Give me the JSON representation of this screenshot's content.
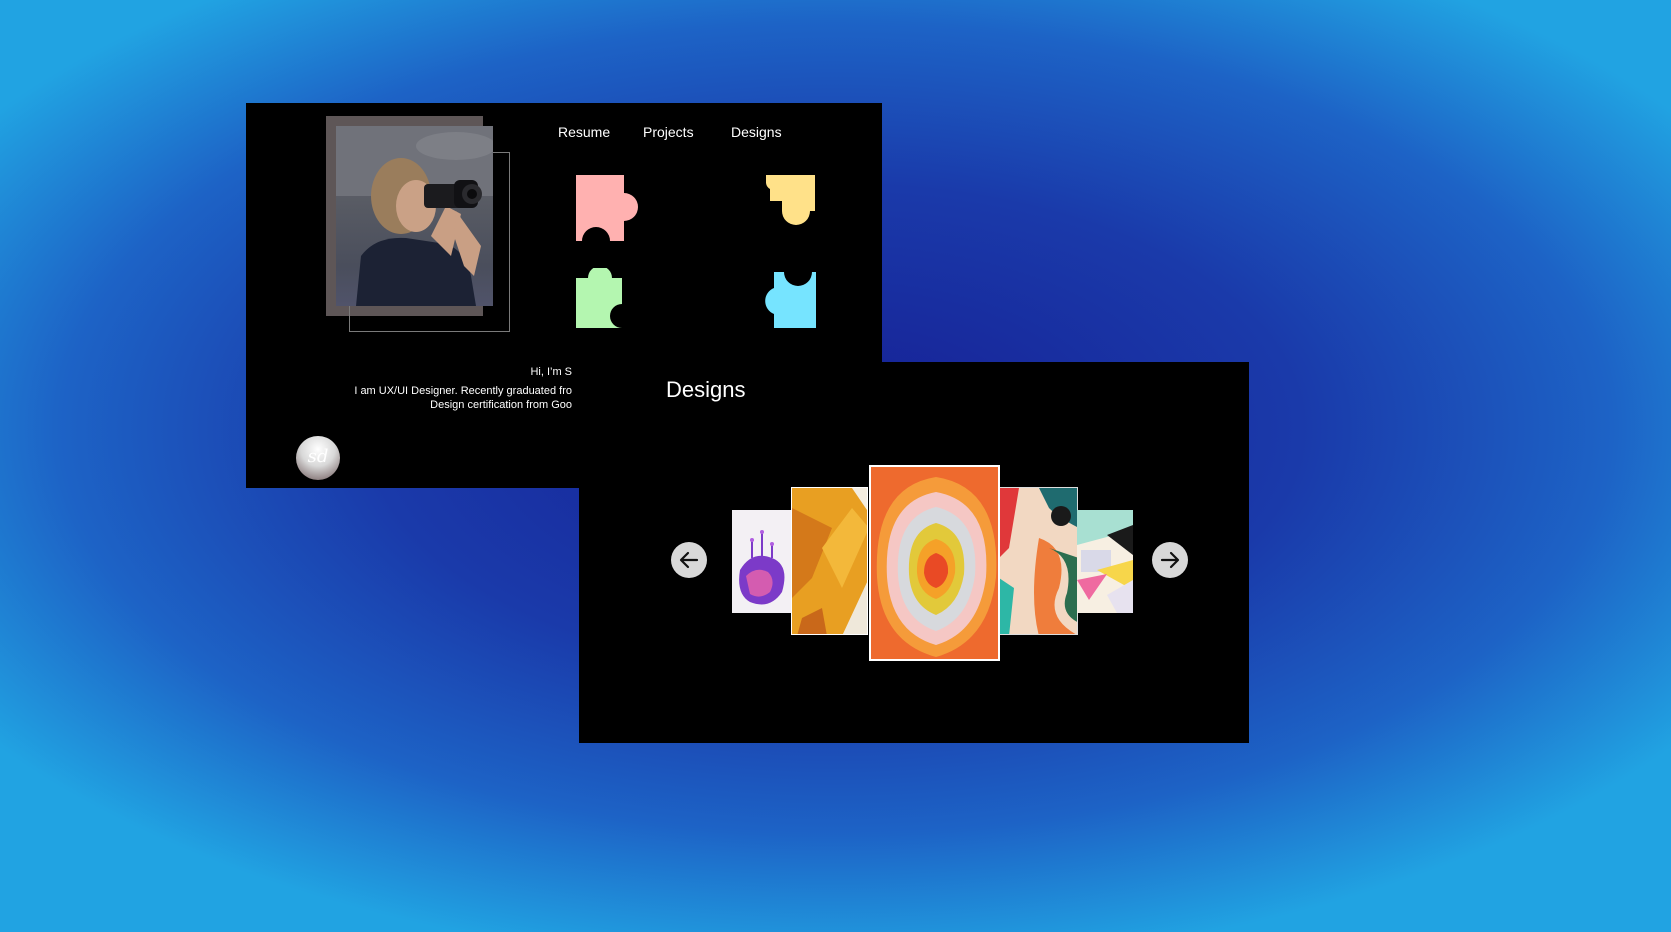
{
  "home": {
    "nav": {
      "resume": "Resume",
      "projects": "Projects",
      "designs": "Designs"
    },
    "bio": {
      "greeting": "Hi, I’m S",
      "line1": "I am UX/UI Designer. Recently graduated fro",
      "line2": "Design certification from Goo"
    },
    "logo_text": "sd",
    "puzzle_colors": [
      "#ffb1b0",
      "#ffe189",
      "#b4f6b0",
      "#76e4ff"
    ]
  },
  "designs_panel": {
    "title": "Designs",
    "prev_icon": "arrow-left-icon",
    "next_icon": "arrow-right-icon"
  },
  "colors": {
    "card_bg": "#000000",
    "background_center": "#161f94",
    "background_edge": "#21a3e2",
    "arrow_button": "#d8d8d8"
  }
}
